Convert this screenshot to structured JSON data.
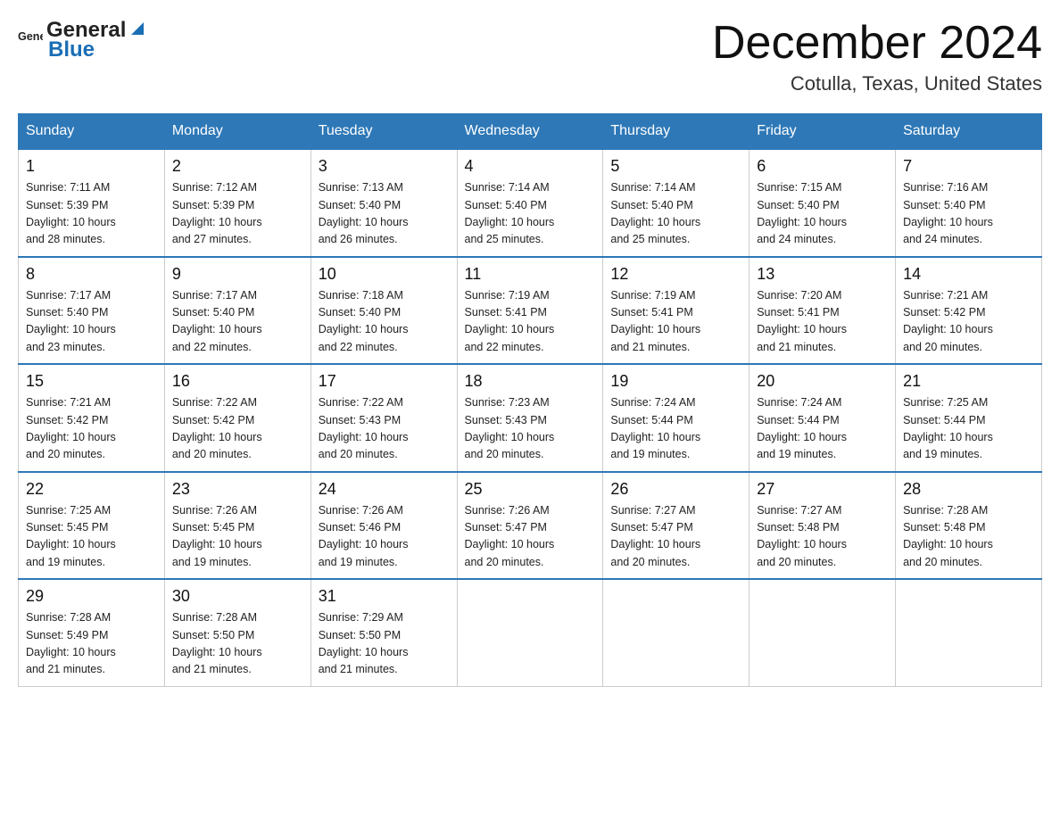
{
  "logo": {
    "text_general": "General",
    "text_blue": "Blue"
  },
  "title": {
    "month": "December 2024",
    "location": "Cotulla, Texas, United States"
  },
  "headers": [
    "Sunday",
    "Monday",
    "Tuesday",
    "Wednesday",
    "Thursday",
    "Friday",
    "Saturday"
  ],
  "weeks": [
    [
      {
        "day": "1",
        "sunrise": "7:11 AM",
        "sunset": "5:39 PM",
        "daylight": "10 hours and 28 minutes."
      },
      {
        "day": "2",
        "sunrise": "7:12 AM",
        "sunset": "5:39 PM",
        "daylight": "10 hours and 27 minutes."
      },
      {
        "day": "3",
        "sunrise": "7:13 AM",
        "sunset": "5:40 PM",
        "daylight": "10 hours and 26 minutes."
      },
      {
        "day": "4",
        "sunrise": "7:14 AM",
        "sunset": "5:40 PM",
        "daylight": "10 hours and 25 minutes."
      },
      {
        "day": "5",
        "sunrise": "7:14 AM",
        "sunset": "5:40 PM",
        "daylight": "10 hours and 25 minutes."
      },
      {
        "day": "6",
        "sunrise": "7:15 AM",
        "sunset": "5:40 PM",
        "daylight": "10 hours and 24 minutes."
      },
      {
        "day": "7",
        "sunrise": "7:16 AM",
        "sunset": "5:40 PM",
        "daylight": "10 hours and 24 minutes."
      }
    ],
    [
      {
        "day": "8",
        "sunrise": "7:17 AM",
        "sunset": "5:40 PM",
        "daylight": "10 hours and 23 minutes."
      },
      {
        "day": "9",
        "sunrise": "7:17 AM",
        "sunset": "5:40 PM",
        "daylight": "10 hours and 22 minutes."
      },
      {
        "day": "10",
        "sunrise": "7:18 AM",
        "sunset": "5:40 PM",
        "daylight": "10 hours and 22 minutes."
      },
      {
        "day": "11",
        "sunrise": "7:19 AM",
        "sunset": "5:41 PM",
        "daylight": "10 hours and 22 minutes."
      },
      {
        "day": "12",
        "sunrise": "7:19 AM",
        "sunset": "5:41 PM",
        "daylight": "10 hours and 21 minutes."
      },
      {
        "day": "13",
        "sunrise": "7:20 AM",
        "sunset": "5:41 PM",
        "daylight": "10 hours and 21 minutes."
      },
      {
        "day": "14",
        "sunrise": "7:21 AM",
        "sunset": "5:42 PM",
        "daylight": "10 hours and 20 minutes."
      }
    ],
    [
      {
        "day": "15",
        "sunrise": "7:21 AM",
        "sunset": "5:42 PM",
        "daylight": "10 hours and 20 minutes."
      },
      {
        "day": "16",
        "sunrise": "7:22 AM",
        "sunset": "5:42 PM",
        "daylight": "10 hours and 20 minutes."
      },
      {
        "day": "17",
        "sunrise": "7:22 AM",
        "sunset": "5:43 PM",
        "daylight": "10 hours and 20 minutes."
      },
      {
        "day": "18",
        "sunrise": "7:23 AM",
        "sunset": "5:43 PM",
        "daylight": "10 hours and 20 minutes."
      },
      {
        "day": "19",
        "sunrise": "7:24 AM",
        "sunset": "5:44 PM",
        "daylight": "10 hours and 19 minutes."
      },
      {
        "day": "20",
        "sunrise": "7:24 AM",
        "sunset": "5:44 PM",
        "daylight": "10 hours and 19 minutes."
      },
      {
        "day": "21",
        "sunrise": "7:25 AM",
        "sunset": "5:44 PM",
        "daylight": "10 hours and 19 minutes."
      }
    ],
    [
      {
        "day": "22",
        "sunrise": "7:25 AM",
        "sunset": "5:45 PM",
        "daylight": "10 hours and 19 minutes."
      },
      {
        "day": "23",
        "sunrise": "7:26 AM",
        "sunset": "5:45 PM",
        "daylight": "10 hours and 19 minutes."
      },
      {
        "day": "24",
        "sunrise": "7:26 AM",
        "sunset": "5:46 PM",
        "daylight": "10 hours and 19 minutes."
      },
      {
        "day": "25",
        "sunrise": "7:26 AM",
        "sunset": "5:47 PM",
        "daylight": "10 hours and 20 minutes."
      },
      {
        "day": "26",
        "sunrise": "7:27 AM",
        "sunset": "5:47 PM",
        "daylight": "10 hours and 20 minutes."
      },
      {
        "day": "27",
        "sunrise": "7:27 AM",
        "sunset": "5:48 PM",
        "daylight": "10 hours and 20 minutes."
      },
      {
        "day": "28",
        "sunrise": "7:28 AM",
        "sunset": "5:48 PM",
        "daylight": "10 hours and 20 minutes."
      }
    ],
    [
      {
        "day": "29",
        "sunrise": "7:28 AM",
        "sunset": "5:49 PM",
        "daylight": "10 hours and 21 minutes."
      },
      {
        "day": "30",
        "sunrise": "7:28 AM",
        "sunset": "5:50 PM",
        "daylight": "10 hours and 21 minutes."
      },
      {
        "day": "31",
        "sunrise": "7:29 AM",
        "sunset": "5:50 PM",
        "daylight": "10 hours and 21 minutes."
      },
      null,
      null,
      null,
      null
    ]
  ],
  "labels": {
    "sunrise": "Sunrise:",
    "sunset": "Sunset:",
    "daylight": "Daylight:"
  }
}
